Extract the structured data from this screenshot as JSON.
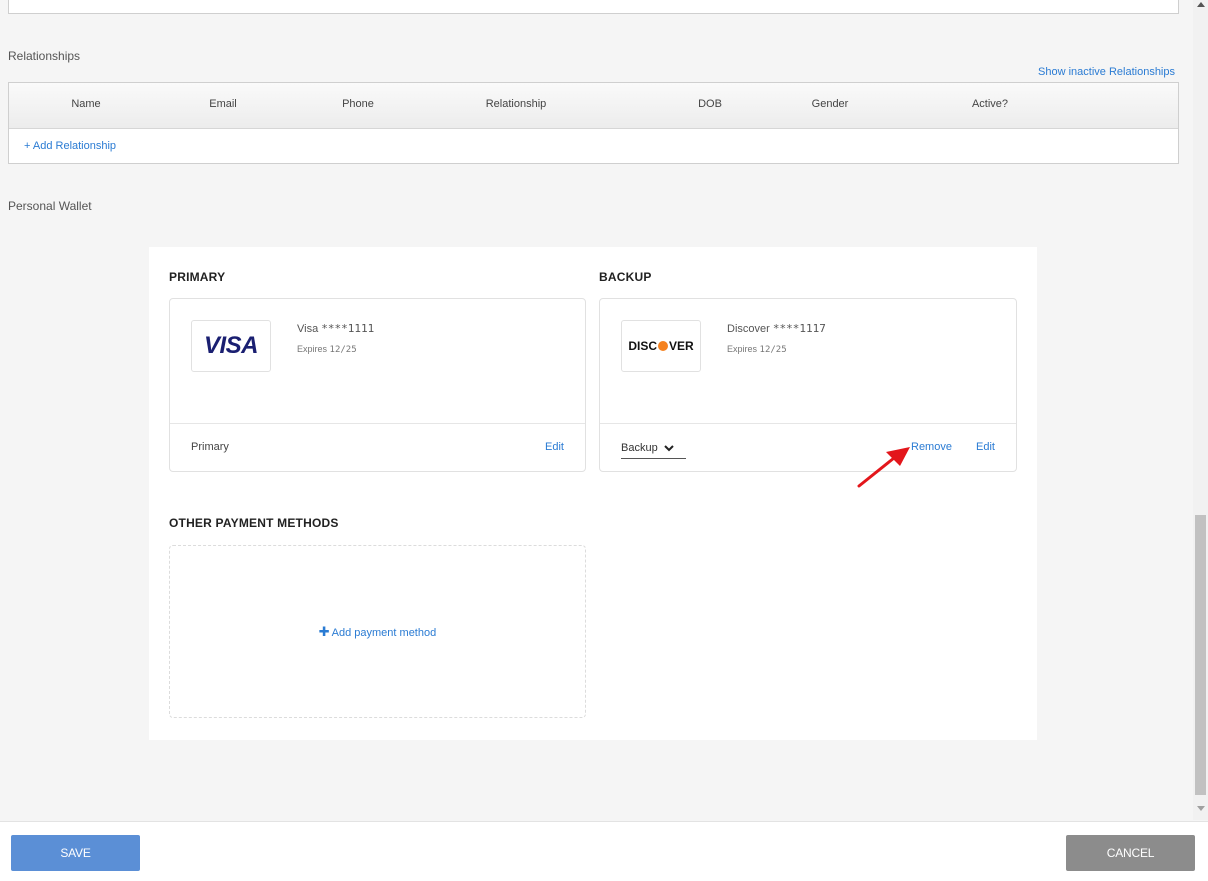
{
  "relationships": {
    "title": "Relationships",
    "show_inactive": "Show inactive Relationships",
    "columns": [
      "Name",
      "Email",
      "Phone",
      "Relationship",
      "DOB",
      "Gender",
      "Active?"
    ],
    "add_label": "+ Add Relationship"
  },
  "wallet": {
    "title": "Personal Wallet",
    "primary": {
      "heading": "PRIMARY",
      "logo_text": "VISA",
      "card_brand": "Visa",
      "card_mask": "****1111",
      "expires_label": "Expires",
      "expires_value": "12/25",
      "footer_label": "Primary",
      "edit_label": "Edit"
    },
    "backup": {
      "heading": "BACKUP",
      "logo_text_left": "DISC",
      "logo_text_right": "VER",
      "card_brand": "Discover",
      "card_mask": "****1117",
      "expires_label": "Expires",
      "expires_value": "12/25",
      "select_value": "Backup",
      "remove_label": "Remove",
      "edit_label": "Edit"
    },
    "other": {
      "heading": "OTHER PAYMENT METHODS",
      "add_label": "Add payment method"
    }
  },
  "footer": {
    "save_label": "SAVE",
    "cancel_label": "CANCEL"
  },
  "colors": {
    "link": "#2a7bd3",
    "save_button": "#5b8fd6",
    "cancel_button": "#8c8c8c",
    "annotation_arrow": "#e3161b",
    "discover_accent": "#f58220",
    "visa_brand": "#1a1f71"
  },
  "icons": {
    "chevron": "chevron-down-icon",
    "plus": "plus-icon",
    "annotation": "annotation-arrow-icon"
  }
}
